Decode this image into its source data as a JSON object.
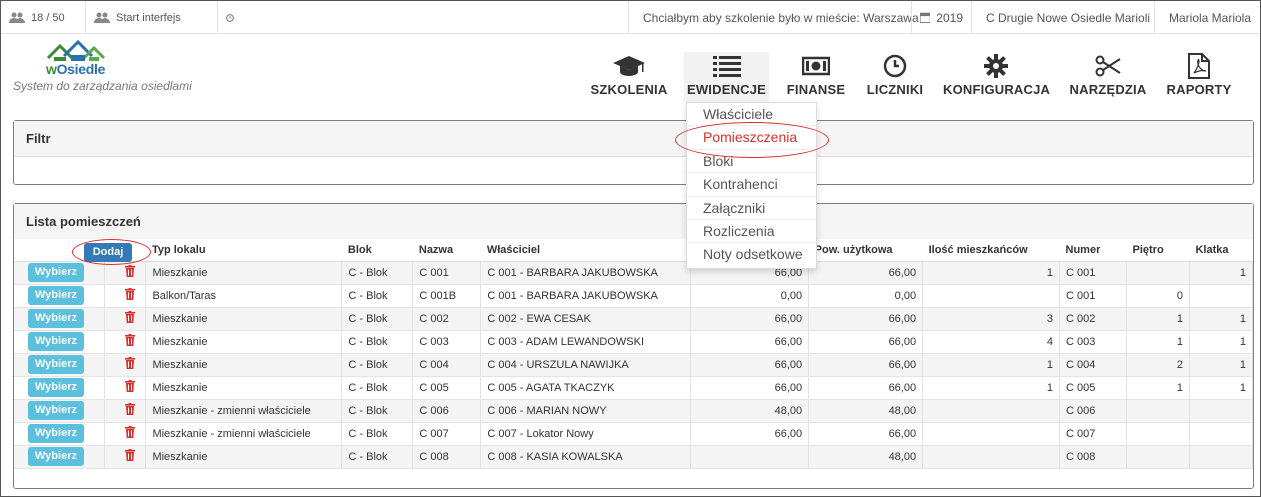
{
  "topbar": {
    "users_count": "18 / 50",
    "start_label": "Start interfejs",
    "city_pref": "Chciałbym aby szkolenie było w mieście: Warszawa",
    "year": "2019",
    "estate": "C Drugie Nowe Osiedle Marioli",
    "user": "Mariola Mariola"
  },
  "brand": {
    "logo_text_w": "w",
    "logo_text_rest": "Osiedle",
    "subtitle": "System do zarządzania osiedlami"
  },
  "nav": {
    "szkolenia": "SZKOLENIA",
    "ewidencje": "EWIDENCJE",
    "finanse": "FINANSE",
    "liczniki": "LICZNIKI",
    "konfiguracja": "KONFIGURACJA",
    "narzedzia": "NARZĘDZIA",
    "raporty": "RAPORTY"
  },
  "dropdown": {
    "items": [
      "Właściciele",
      "Pomieszczenia",
      "Bloki",
      "Kontrahenci",
      "Załączniki",
      "Rozliczenia",
      "Noty odsetkowe"
    ]
  },
  "filter": {
    "title": "Filtr"
  },
  "list": {
    "title": "Lista pomieszczeń",
    "add_label": "Dodaj",
    "select_label": "Wybierz",
    "columns": [
      "Typ lokalu",
      "Blok",
      "Nazwa",
      "Właściciel",
      "",
      "Pow. użytkowa",
      "Ilość mieszkańców",
      "Numer",
      "Piętro",
      "Klatka"
    ],
    "rows": [
      [
        "Mieszkanie",
        "C - Blok",
        "C 001",
        "C 001 - BARBARA JAKUBOWSKA",
        "66,00",
        "66,00",
        "1",
        "C 001",
        "",
        "1"
      ],
      [
        "Balkon/Taras",
        "C - Blok",
        "C 001B",
        "C 001 - BARBARA JAKUBOWSKA",
        "0,00",
        "0,00",
        "",
        "C 001",
        "0",
        ""
      ],
      [
        "Mieszkanie",
        "C - Blok",
        "C 002",
        "C 002 - EWA CESAK",
        "66,00",
        "66,00",
        "3",
        "C 002",
        "1",
        "1"
      ],
      [
        "Mieszkanie",
        "C - Blok",
        "C 003",
        "C 003 - ADAM LEWANDOWSKI",
        "66,00",
        "66,00",
        "4",
        "C 003",
        "1",
        "1"
      ],
      [
        "Mieszkanie",
        "C - Blok",
        "C 004",
        "C 004 - URSZULA NAWIJKA",
        "66,00",
        "66,00",
        "1",
        "C 004",
        "2",
        "1"
      ],
      [
        "Mieszkanie",
        "C - Blok",
        "C 005",
        "C 005 - AGATA TKACZYK",
        "66,00",
        "66,00",
        "1",
        "C 005",
        "1",
        "1"
      ],
      [
        "Mieszkanie - zmienni właściciele",
        "C - Blok",
        "C 006",
        "C 006 - MARIAN NOWY",
        "48,00",
        "48,00",
        "",
        "C 006",
        "",
        ""
      ],
      [
        "Mieszkanie - zmienni właściciele",
        "C - Blok",
        "C 007",
        "C 007 - Lokator Nowy",
        "66,00",
        "66,00",
        "",
        "C 007",
        "",
        ""
      ],
      [
        "Mieszkanie",
        "C - Blok",
        "C 008",
        "C 008 - KASIA KOWALSKA",
        "",
        "48,00",
        "",
        "C 008",
        "",
        ""
      ]
    ]
  },
  "colors": {
    "accent": "#337ab7",
    "info": "#5bc0de",
    "danger": "#d9302c"
  }
}
